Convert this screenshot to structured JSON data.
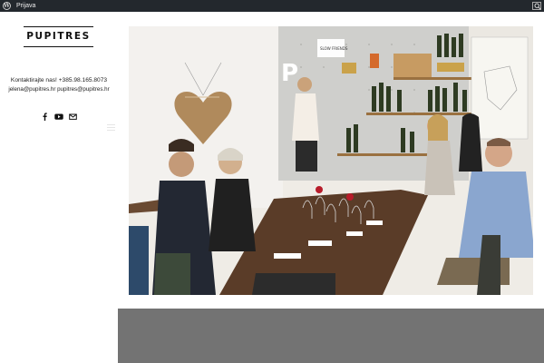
{
  "admin_bar": {
    "login_label": "Prijava",
    "wp_icon": "wordpress-icon",
    "search_icon": "search-icon"
  },
  "sidebar": {
    "logo_text": "PUPITRES",
    "contact_line1": "Kontaktirajte nas! +385.98.165.8073",
    "contact_line2": "jelena@pupitres.hr pupitres@pupitres.hr",
    "social": [
      "facebook-icon",
      "youtube-icon",
      "email-icon"
    ],
    "menu_toggle_icon": "hamburger-icon"
  },
  "photo": {
    "description_icon": "wine-tasting-photo",
    "sign_text": "P",
    "shelf_label": "SLOW FRIENDS"
  },
  "colors": {
    "admin_bar": "#23282d",
    "lower_band": "#737373",
    "logo": "#111111"
  }
}
